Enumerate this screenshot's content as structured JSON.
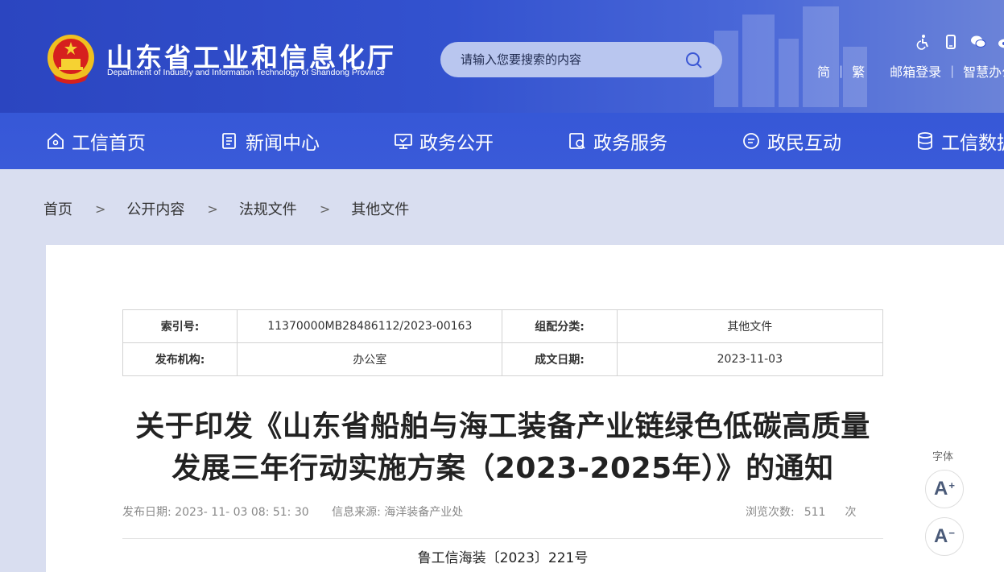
{
  "header": {
    "site_title": "山东省工业和信息化厅",
    "site_subtitle": "Department of Industry and Information Technology of Shandong Province",
    "search_placeholder": "请输入您要搜索的内容",
    "util_icons": [
      "accessibility-icon",
      "mobile-icon",
      "wechat-icon",
      "weibo-icon"
    ],
    "util_links": [
      "简",
      "繁",
      "邮箱登录",
      "智慧办公"
    ]
  },
  "nav": {
    "items": [
      {
        "label": "工信首页",
        "icon": "home-icon"
      },
      {
        "label": "新闻中心",
        "icon": "news-icon"
      },
      {
        "label": "政务公开",
        "icon": "monitor-icon"
      },
      {
        "label": "政务服务",
        "icon": "service-icon"
      },
      {
        "label": "政民互动",
        "icon": "chat-icon"
      },
      {
        "label": "工信数据",
        "icon": "database-icon"
      }
    ]
  },
  "breadcrumb": {
    "items": [
      "首页",
      "公开内容",
      "法规文件",
      "其他文件"
    ],
    "separator": ">"
  },
  "meta": {
    "index_key": "索引号:",
    "index_val": "11370000MB28486112/2023-00163",
    "category_key": "组配分类:",
    "category_val": "其他文件",
    "publisher_key": "发布机构:",
    "publisher_val": "办公室",
    "date_key": "成文日期:",
    "date_val": "2023-11-03"
  },
  "article": {
    "title": "关于印发《山东省船舶与海工装备产业链绿色低碳高质量发展三年行动实施方案（2023-2025年）》的通知",
    "publish_date": "发布日期: 2023- 11- 03 08: 51: 30",
    "source": "信息来源: 海洋装备产业处",
    "views_label": "浏览次数:",
    "views_count": "511",
    "views_unit": "次",
    "doc_number": "鲁工信海装〔2023〕221号"
  },
  "font_tools": {
    "label": "字体",
    "increase": "A",
    "increase_sup": "+",
    "decrease": "A",
    "decrease_sup": "−"
  },
  "colors": {
    "header_blue": "#3352cf",
    "breadcrumb_bg": "#d9def0"
  }
}
